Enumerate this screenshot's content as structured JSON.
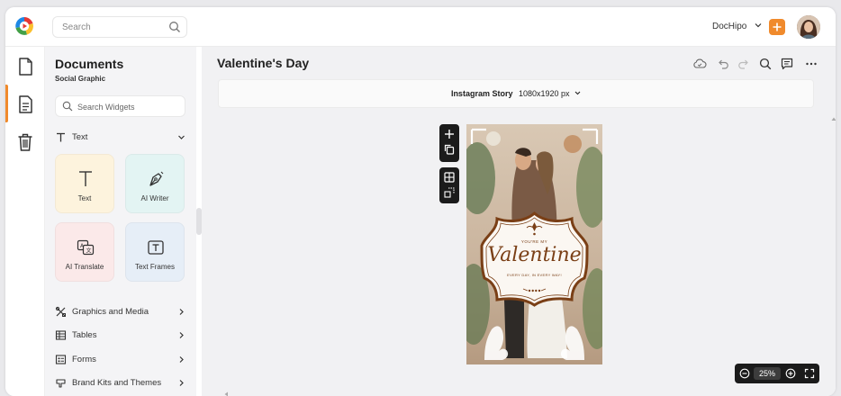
{
  "topbar": {
    "search_placeholder": "Search",
    "account_name": "DocHipo"
  },
  "panel": {
    "title": "Documents",
    "subtitle": "Social Graphic",
    "widget_search_placeholder": "Search Widgets",
    "text_section_label": "Text",
    "cards": [
      {
        "label": "Text",
        "color": "#fdf3dd"
      },
      {
        "label": "AI Writer",
        "color": "#e3f4f3"
      },
      {
        "label": "AI Translate",
        "color": "#fbe9e9"
      },
      {
        "label": "Text Frames",
        "color": "#e6eef7"
      }
    ],
    "sections": [
      {
        "label": "Graphics and Media"
      },
      {
        "label": "Tables"
      },
      {
        "label": "Forms"
      },
      {
        "label": "Brand Kits and Themes"
      }
    ]
  },
  "main": {
    "doc_title": "Valentine's Day",
    "size_name": "Instagram Story",
    "size_dims": "1080x1920 px",
    "zoom": "25%"
  },
  "design": {
    "small_line": "YOU'RE MY",
    "script_word": "Valentine",
    "tagline": "EVERY DAY, IN EVERY WAY!"
  },
  "colors": {
    "accent": "#f08a2c",
    "panel_bg": "#f4f4f6",
    "workspace_bg": "#f1f1f3",
    "frame_brown": "#7a3f16"
  },
  "icons": {
    "logo": "dochipo-logo",
    "rail": [
      "document-icon",
      "page-icon",
      "trash-icon"
    ],
    "toolbar": [
      "cloud-save-icon",
      "undo-icon",
      "redo-icon",
      "search-icon",
      "comment-icon",
      "more-icon"
    ]
  }
}
